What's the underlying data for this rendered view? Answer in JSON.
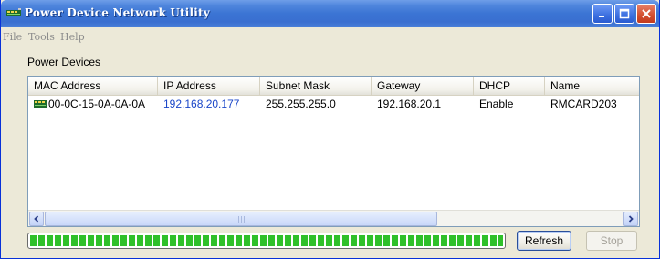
{
  "window": {
    "title": "Power Device Network Utility",
    "title_color": "#3a6fd0",
    "icons": [
      "app-icon",
      "minimize-icon",
      "maximize-icon",
      "close-icon"
    ]
  },
  "menu": {
    "items": [
      "File",
      "Tools",
      "Help"
    ]
  },
  "devices": {
    "group_label": "Power Devices",
    "columns": [
      "MAC Address",
      "IP Address",
      "Subnet Mask",
      "Gateway",
      "DHCP",
      "Name"
    ],
    "rows": [
      {
        "icon": "network-device-icon",
        "mac": "00-0C-15-0A-0A-0A",
        "ip": "192.168.20.177",
        "subnet": "255.255.255.0",
        "gateway": "192.168.20.1",
        "dhcp": "Enable",
        "name": "RMCARD203"
      }
    ]
  },
  "status": {
    "progress_percent": 100,
    "progress_color": "#2fc02a"
  },
  "buttons": {
    "refresh": "Refresh",
    "stop": "Stop"
  }
}
